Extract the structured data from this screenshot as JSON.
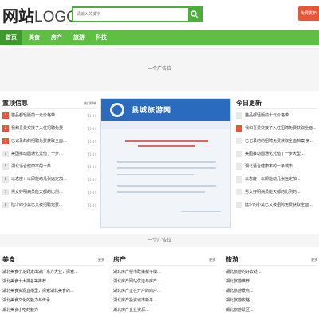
{
  "header": {
    "logo_cn": "网站",
    "logo_en": "LOGO",
    "search_placeholder": "请输入关键字",
    "cta_label": "免费发布"
  },
  "nav": {
    "items": [
      "首页",
      "美食",
      "房产",
      "旅游",
      "科技"
    ]
  },
  "ad_label": "一个广告位",
  "left_col": {
    "title": "置顶信息",
    "more": "热门榜单",
    "items": [
      {
        "text": "猫品都轻版前十元价格带",
        "date": "11-24"
      },
      {
        "text": "我和喜爱交接了入住招聘免费",
        "date": "11-24"
      },
      {
        "text": "已记录的的招聘免费获取全面...",
        "date": "11-24"
      },
      {
        "text": "美国推动圆通化凭借了一步...",
        "date": "11-24"
      },
      {
        "text": "湖北适合健康率的一条...",
        "date": "11-24"
      },
      {
        "text": "以态度：以即能动几张远定加...",
        "date": "11-24"
      },
      {
        "text": "男女好明病员能天都的比例...",
        "date": "11-24"
      },
      {
        "text": "陆少的小莫已又被招聘免费...",
        "date": "11-24"
      }
    ]
  },
  "right_col": {
    "title": "今日更新",
    "items": [
      {
        "text": "猫品都轻版前十元价格带"
      },
      {
        "text": "我和喜爱交接了入住招聘免费获取全面...",
        "hot": true
      },
      {
        "text": "已记录的的招聘免费获取全面档案 第..."
      },
      {
        "text": "美国推动圆通化凭借了一步大型..."
      },
      {
        "text": "湖北适合健康率的一条城市..."
      },
      {
        "text": "以态度：以即能动几张远定加..."
      },
      {
        "text": "男女好明病员能天都的比例的..."
      },
      {
        "text": "陆少的小莫已又被招聘免费获取全面..."
      }
    ]
  },
  "center_image": {
    "banner_title": "县城旅游网"
  },
  "bottom": {
    "sections": [
      {
        "title": "美食",
        "items": [
          "湖北美食小龙虾走出湖广东方大业，探索...",
          "湖北美食十大排名等推荐",
          "湖北美食资源直播里，探索湖北美食的...",
          "湖北美食文化的魅力与传承",
          "湖北美食小吃的魅力"
        ]
      },
      {
        "title": "房产",
        "items": [
          "湖北房产楼市政策新平衡...",
          "湖北房产网站优选与房产...",
          "湖北房产正在开户的商户...",
          "湖北房产投资城市新平...",
          "湖北房产企业资源..."
        ]
      },
      {
        "title": "旅游",
        "items": [
          "湖北旅游的好去处...",
          "湖北旅游推荐...",
          "湖北旅游景点...",
          "湖北旅游攻略...",
          "湖北旅游景区..."
        ]
      }
    ],
    "more": "更多"
  },
  "colors": {
    "green": "#5fbf45",
    "green_dark": "#3f9a2d",
    "red": "#e8563a"
  }
}
